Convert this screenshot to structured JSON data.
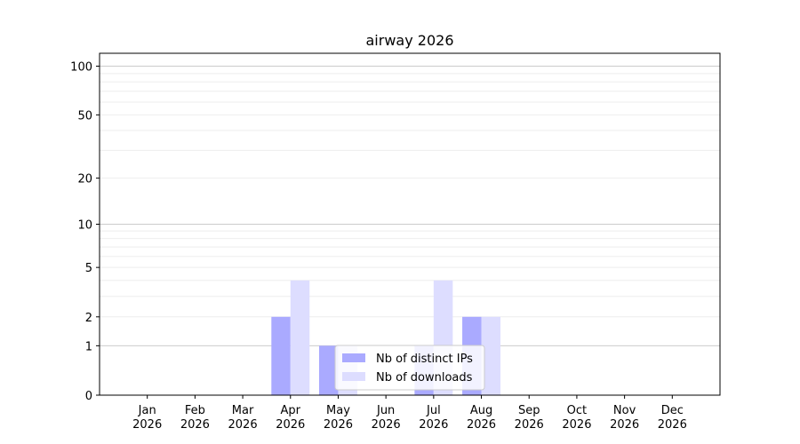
{
  "chart_data": {
    "type": "bar",
    "title": "airway 2026",
    "xlabel": "",
    "ylabel": "",
    "yscale": "symlog",
    "ylim": [
      0,
      120
    ],
    "y_ticks": [
      0,
      1,
      2,
      5,
      10,
      20,
      50,
      100
    ],
    "categories": [
      [
        "Jan",
        "2026"
      ],
      [
        "Feb",
        "2026"
      ],
      [
        "Mar",
        "2026"
      ],
      [
        "Apr",
        "2026"
      ],
      [
        "May",
        "2026"
      ],
      [
        "Jun",
        "2026"
      ],
      [
        "Jul",
        "2026"
      ],
      [
        "Aug",
        "2026"
      ],
      [
        "Sep",
        "2026"
      ],
      [
        "Oct",
        "2026"
      ],
      [
        "Nov",
        "2026"
      ],
      [
        "Dec",
        "2026"
      ]
    ],
    "series": [
      {
        "name": "Nb of distinct IPs",
        "color": "#aaaaff",
        "values": [
          0,
          0,
          0,
          2,
          1,
          0,
          1,
          2,
          0,
          0,
          0,
          0
        ]
      },
      {
        "name": "Nb of downloads",
        "color": "#ddddff",
        "values": [
          0,
          0,
          0,
          4,
          1,
          0,
          4,
          2,
          0,
          0,
          0,
          0
        ]
      }
    ],
    "grid": true,
    "legend_position": "lower-center"
  }
}
